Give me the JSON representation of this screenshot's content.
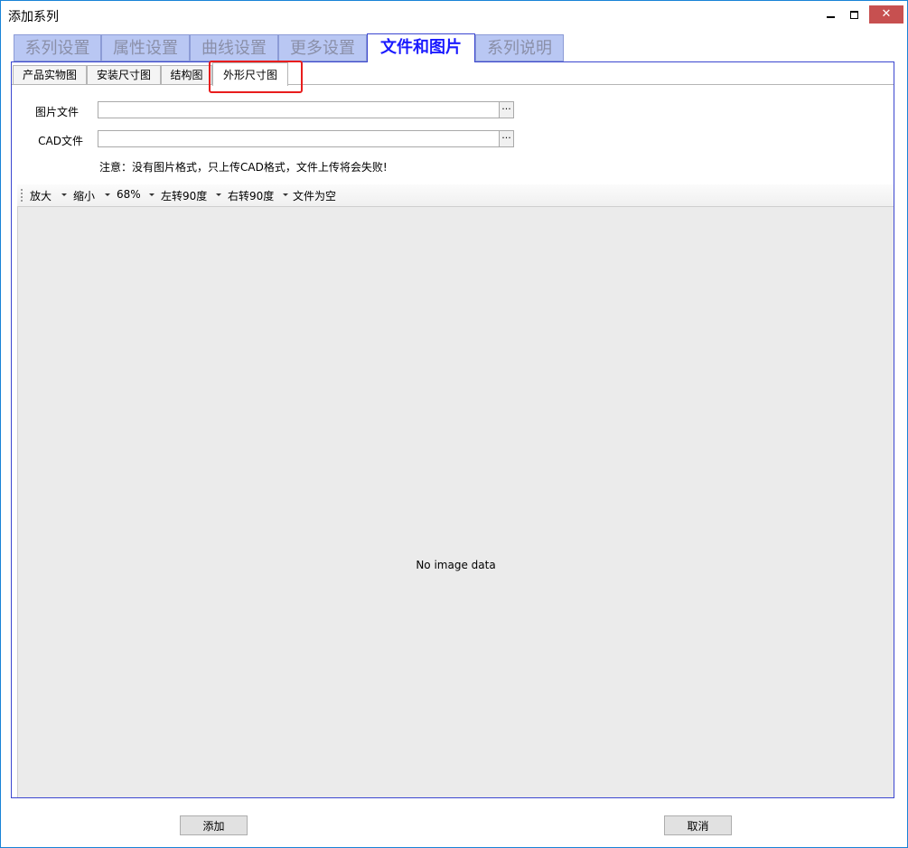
{
  "window": {
    "title": "添加系列",
    "min_label": "",
    "close_label": "✕"
  },
  "main_tabs": [
    {
      "label": "系列设置"
    },
    {
      "label": "属性设置"
    },
    {
      "label": "曲线设置"
    },
    {
      "label": "更多设置"
    },
    {
      "label": "文件和图片"
    },
    {
      "label": "系列说明"
    }
  ],
  "sub_tabs": [
    {
      "label": "产品实物图"
    },
    {
      "label": "安装尺寸图"
    },
    {
      "label": "结构图"
    },
    {
      "label": "外形尺寸图"
    }
  ],
  "form": {
    "image_file_label": "图片文件",
    "image_file_value": "",
    "cad_file_label": "CAD文件",
    "cad_file_value": "",
    "browse_label": "···",
    "note": "注意：没有图片格式，只上传CAD格式，文件上传将会失败!"
  },
  "toolbar": {
    "zoom_in": "放大",
    "zoom_out": "缩小",
    "zoom_level": "68%",
    "rotate_left": "左转90度",
    "rotate_right": "右转90度",
    "file_status": "文件为空"
  },
  "viewer": {
    "empty_text": "No image data"
  },
  "buttons": {
    "add": "添加",
    "cancel": "取消"
  },
  "colors": {
    "active_tab_text": "#1a1aff",
    "inactive_tab_bg": "#b9c7f3",
    "highlight": "#e81d1d",
    "close_button": "#c75050"
  }
}
